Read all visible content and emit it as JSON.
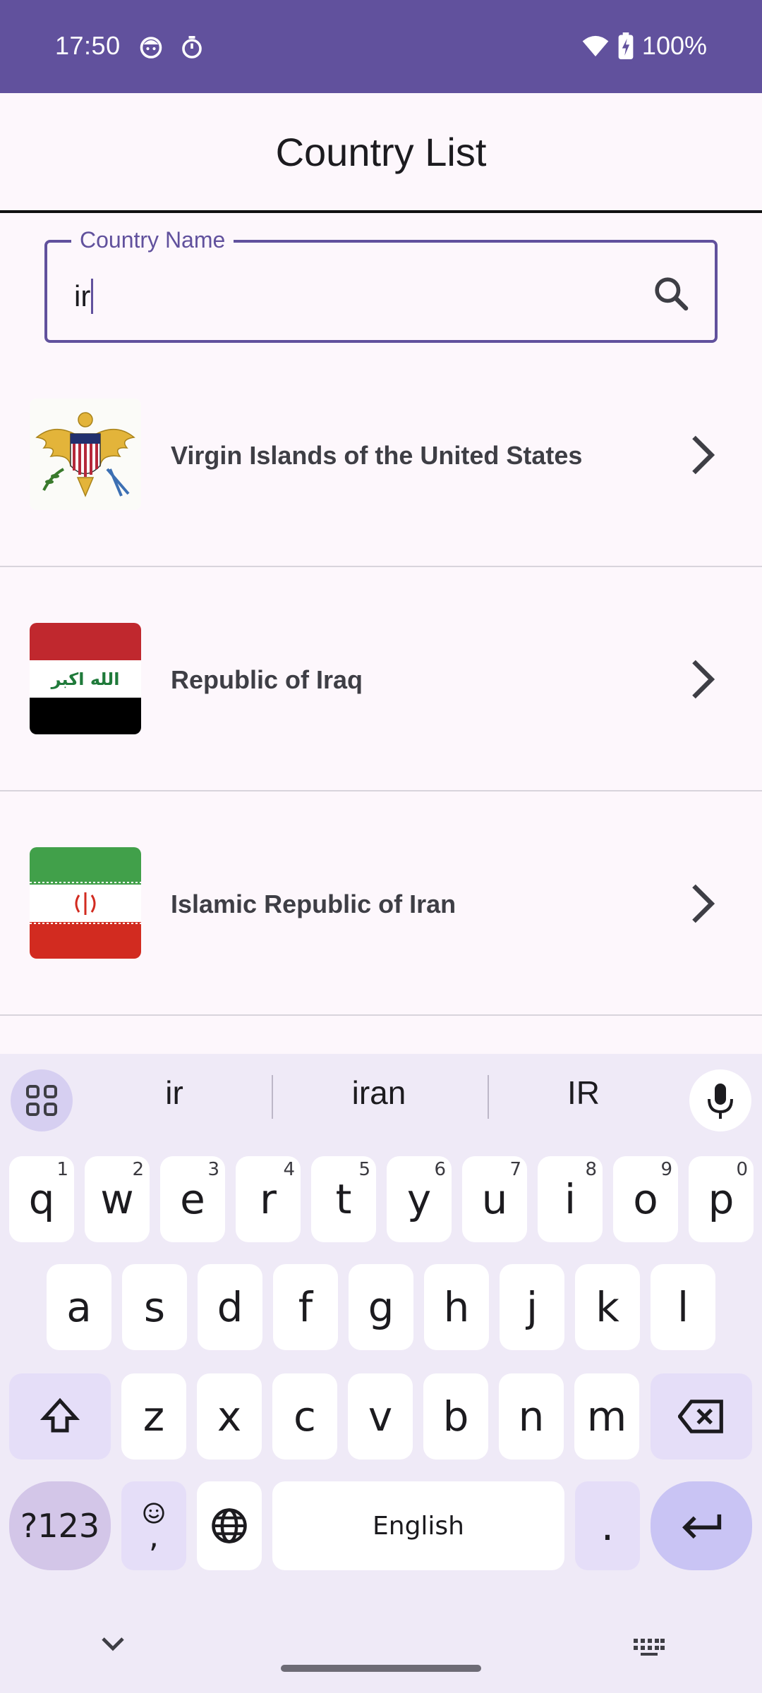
{
  "status_bar": {
    "time": "17:50",
    "battery": "100%",
    "icons": [
      "face-icon",
      "timer-icon",
      "wifi-icon",
      "battery-charging-icon"
    ]
  },
  "header": {
    "title": "Country List"
  },
  "search": {
    "label": "Country Name",
    "value": "ir",
    "icon": "search-icon"
  },
  "countries": [
    {
      "name": "Virgin Islands of the United States",
      "flag": "usvi-flag"
    },
    {
      "name": "Republic of Iraq",
      "flag": "iraq-flag",
      "flag_text": "الله اكبر"
    },
    {
      "name": "Islamic Republic of Iran",
      "flag": "iran-flag"
    }
  ],
  "keyboard": {
    "suggestions": [
      "ir",
      "iran",
      "IR"
    ],
    "row1": [
      {
        "k": "q",
        "h": "1"
      },
      {
        "k": "w",
        "h": "2"
      },
      {
        "k": "e",
        "h": "3"
      },
      {
        "k": "r",
        "h": "4"
      },
      {
        "k": "t",
        "h": "5"
      },
      {
        "k": "y",
        "h": "6"
      },
      {
        "k": "u",
        "h": "7"
      },
      {
        "k": "i",
        "h": "8"
      },
      {
        "k": "o",
        "h": "9"
      },
      {
        "k": "p",
        "h": "0"
      }
    ],
    "row2": [
      "a",
      "s",
      "d",
      "f",
      "g",
      "h",
      "j",
      "k",
      "l"
    ],
    "row3": [
      "z",
      "x",
      "c",
      "v",
      "b",
      "n",
      "m"
    ],
    "symbols_label": "?123",
    "emoji_comma": ",",
    "space_label": "English",
    "period_label": "."
  },
  "colors": {
    "primary": "#61519d",
    "background": "#fdf7fc",
    "keyboard_bg": "#efeaf7"
  }
}
